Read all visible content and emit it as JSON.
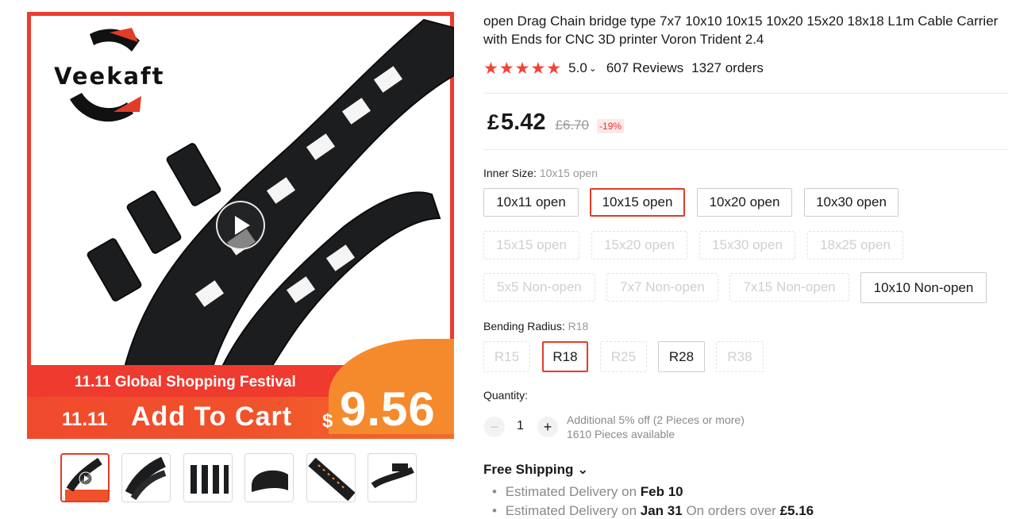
{
  "gallery": {
    "logo_text": "Veekaft",
    "promo_title": "11.11 Global Shopping Festival",
    "promo_cta": "Add To Cart",
    "promo_icon": "11.11",
    "promo_currency": "$",
    "promo_price": "9.56",
    "thumbnail_count": 6
  },
  "product": {
    "title": "open Drag Chain bridge type 7x7 10x10 10x15 10x20 15x20 18x18 L1m Cable Carrier with Ends for CNC 3D printer Voron Trident 2.4",
    "rating": {
      "stars": "★★★★★",
      "score": "5.0",
      "reviews": "607 Reviews",
      "orders": "1327 orders"
    },
    "price": {
      "currency": "£",
      "current": "5.42",
      "original": "£6.70",
      "discount": "-19%"
    }
  },
  "inner_size": {
    "label": "Inner Size:",
    "selected": "10x15 open",
    "options": [
      {
        "label": "10x11 open",
        "state": "normal"
      },
      {
        "label": "10x15 open",
        "state": "active"
      },
      {
        "label": "10x20 open",
        "state": "normal"
      },
      {
        "label": "10x30 open",
        "state": "normal"
      },
      {
        "label": "15x15 open",
        "state": "disabled"
      },
      {
        "label": "15x20 open",
        "state": "disabled"
      },
      {
        "label": "15x30 open",
        "state": "disabled"
      },
      {
        "label": "18x25 open",
        "state": "disabled"
      },
      {
        "label": "5x5 Non-open",
        "state": "disabled"
      },
      {
        "label": "7x7 Non-open",
        "state": "disabled"
      },
      {
        "label": "7x15 Non-open",
        "state": "disabled"
      },
      {
        "label": "10x10 Non-open",
        "state": "normal"
      }
    ]
  },
  "bending_radius": {
    "label": "Bending Radius:",
    "selected": "R18",
    "options": [
      {
        "label": "R15",
        "state": "disabled"
      },
      {
        "label": "R18",
        "state": "active"
      },
      {
        "label": "R25",
        "state": "disabled"
      },
      {
        "label": "R28",
        "state": "normal"
      },
      {
        "label": "R38",
        "state": "disabled"
      }
    ]
  },
  "quantity": {
    "label": "Quantity:",
    "value": "1",
    "minus": "−",
    "plus": "+",
    "note_1": "Additional 5% off (2 Pieces or more)",
    "note_2": "1610 Pieces available"
  },
  "shipping": {
    "title": "Free Shipping",
    "chevron": "⌄",
    "line_1_text": "Estimated Delivery on",
    "line_1_date": "Feb 10",
    "line_2_text": "Estimated Delivery on",
    "line_2_date": "Jan 31",
    "line_2_suffix": "On orders over",
    "line_2_amount": "£5.16"
  },
  "colors": {
    "accent_red": "#e23c28",
    "star_red": "#f54335",
    "promo_orange": "#f58a2c"
  }
}
